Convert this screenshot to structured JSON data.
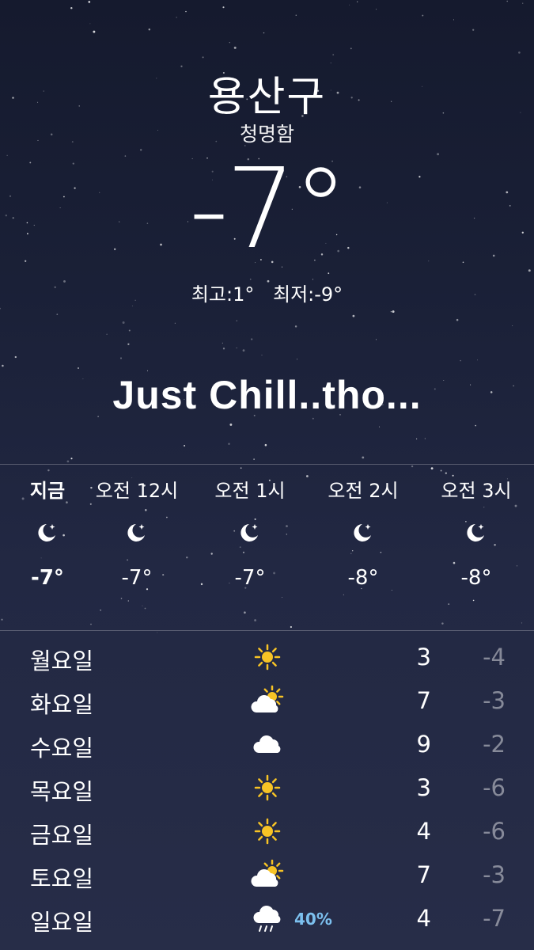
{
  "location": {
    "city": "용산구",
    "condition": "청명함",
    "temperature": "-7°"
  },
  "hilo": {
    "high": "최고:1°",
    "low": "최저:-9°"
  },
  "caption": "Just Chill..tho...",
  "hourly": [
    {
      "label": "지금",
      "icon": "moon-stars-icon",
      "temp": "-7°"
    },
    {
      "label": "오전 12시",
      "icon": "moon-stars-icon",
      "temp": "-7°"
    },
    {
      "label": "오전 1시",
      "icon": "moon-stars-icon",
      "temp": "-7°"
    },
    {
      "label": "오전 2시",
      "icon": "moon-stars-icon",
      "temp": "-8°"
    },
    {
      "label": "오전 3시",
      "icon": "moon-stars-icon",
      "temp": "-8°"
    }
  ],
  "daily": [
    {
      "day": "월요일",
      "icon": "sun-icon",
      "precip": "",
      "high": "3",
      "low": "-4"
    },
    {
      "day": "화요일",
      "icon": "partly-cloudy-icon",
      "precip": "",
      "high": "7",
      "low": "-3"
    },
    {
      "day": "수요일",
      "icon": "cloud-icon",
      "precip": "",
      "high": "9",
      "low": "-2"
    },
    {
      "day": "목요일",
      "icon": "sun-icon",
      "precip": "",
      "high": "3",
      "low": "-6"
    },
    {
      "day": "금요일",
      "icon": "sun-icon",
      "precip": "",
      "high": "4",
      "low": "-6"
    },
    {
      "day": "토요일",
      "icon": "partly-cloudy-icon",
      "precip": "",
      "high": "7",
      "low": "-3"
    },
    {
      "day": "일요일",
      "icon": "rain-icon",
      "precip": "40%",
      "high": "4",
      "low": "-7"
    }
  ],
  "colors": {
    "sun": "#f7c325",
    "precipitation": "#7cc0ef"
  }
}
